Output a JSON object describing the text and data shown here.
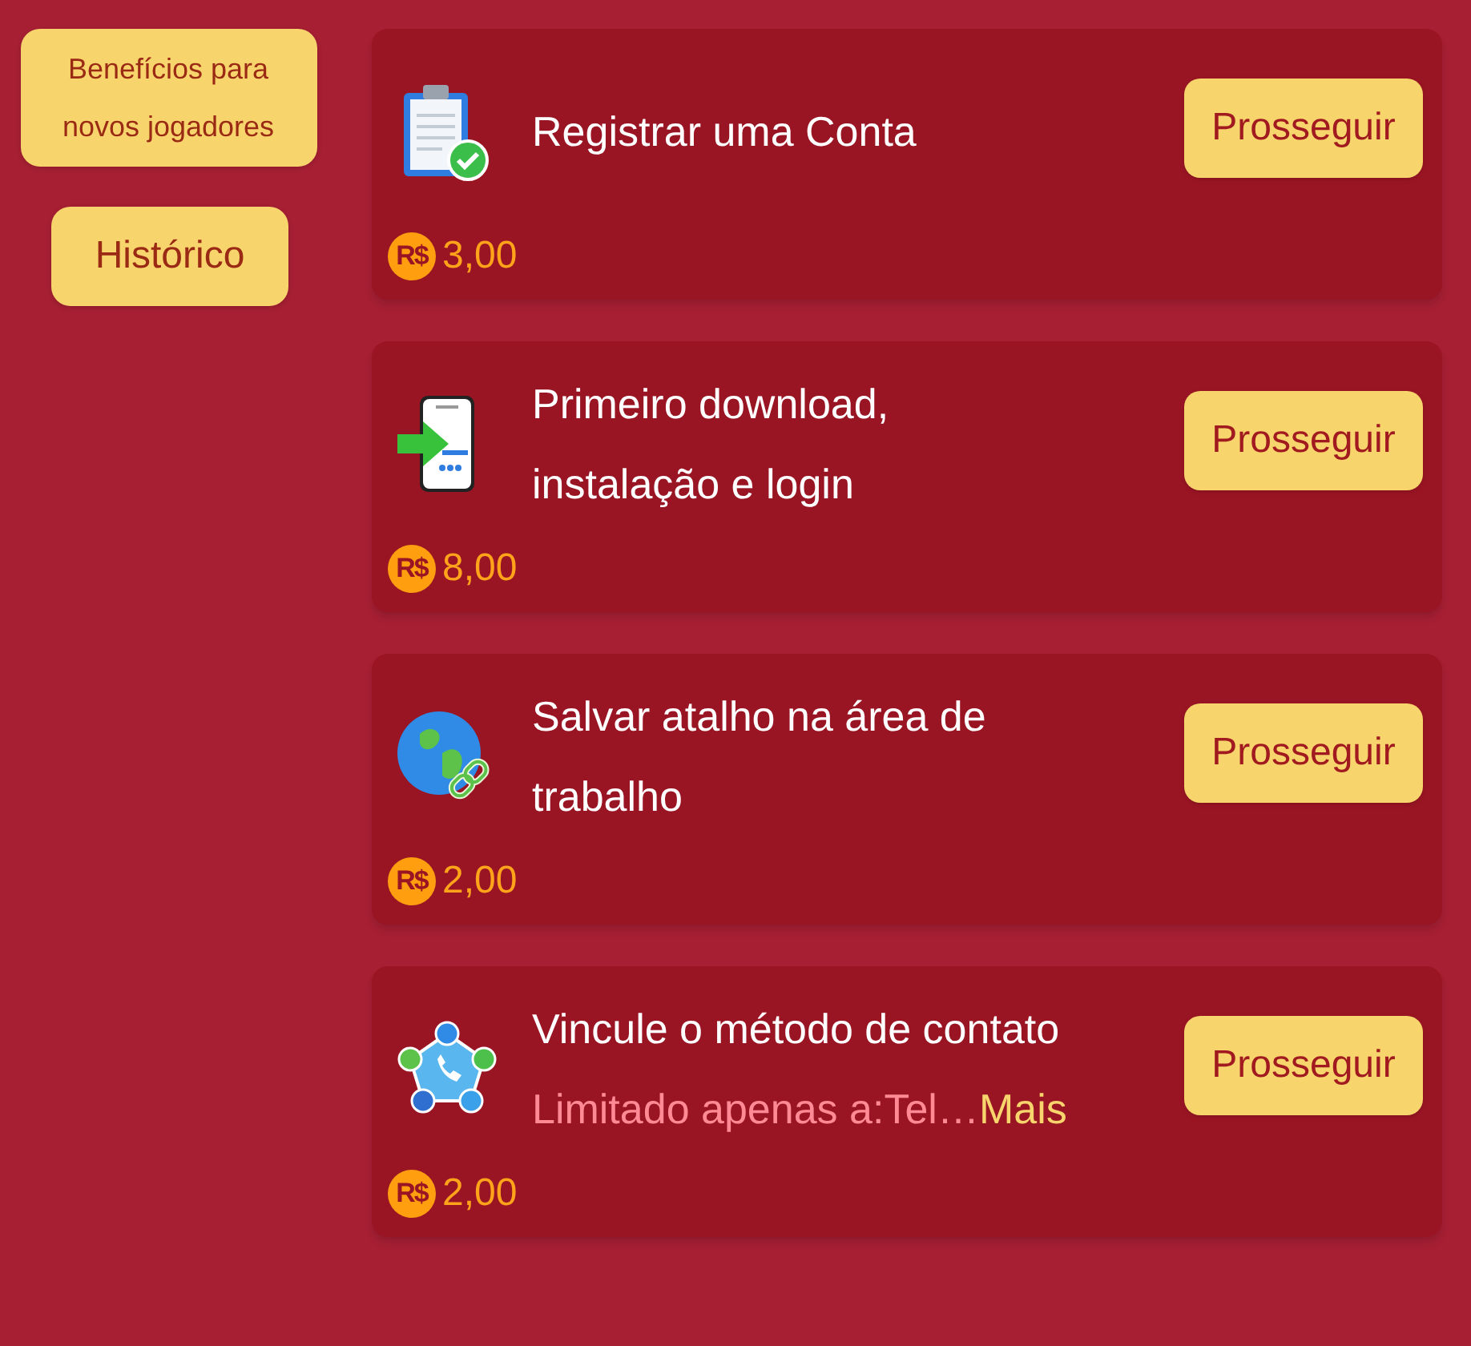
{
  "sidebar": {
    "items": [
      {
        "label": "Benefícios para novos jogadores"
      },
      {
        "label": "Histórico"
      }
    ]
  },
  "tasks": [
    {
      "title": "Registrar uma Conta",
      "currency": "R$",
      "reward": "3,00",
      "button": "Prosseguir"
    },
    {
      "title": "Primeiro download, instalação e login",
      "currency": "R$",
      "reward": "8,00",
      "button": "Prosseguir"
    },
    {
      "title": "Salvar atalho na área de trabalho",
      "currency": "R$",
      "reward": "2,00",
      "button": "Prosseguir"
    },
    {
      "title": "Vincule o método de contato",
      "note": "Limitado apenas a:Tel…",
      "more": "Mais",
      "currency": "R$",
      "reward": "2,00",
      "button": "Prosseguir"
    }
  ]
}
